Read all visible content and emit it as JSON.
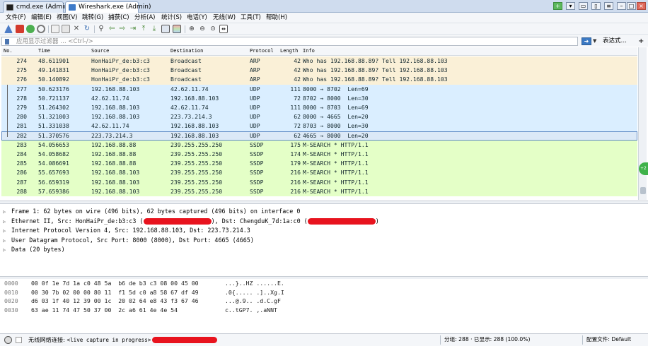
{
  "window": {
    "tabs": [
      {
        "label": "cmd.exe (Admin)",
        "active": false
      },
      {
        "label": "Wireshark.exe (Admin)",
        "active": true
      }
    ]
  },
  "menu": [
    "文件(F)",
    "编辑(E)",
    "视图(V)",
    "跳转(G)",
    "捕获(C)",
    "分析(A)",
    "统计(S)",
    "电话(Y)",
    "无线(W)",
    "工具(T)",
    "帮助(H)"
  ],
  "toolbar_icons": [
    "shark-fin-start-icon",
    "stop-icon",
    "restart-icon",
    "options-gear-icon",
    "open-file-icon",
    "save-file-icon",
    "close-file-icon",
    "reload-icon",
    "find-packet-icon",
    "go-back-icon",
    "go-forward-icon",
    "go-to-packet-icon",
    "first-packet-icon",
    "last-packet-icon",
    "autoscroll-icon",
    "colorize-icon",
    "zoom-in-icon",
    "zoom-out-icon",
    "normal-size-icon",
    "resize-columns-icon"
  ],
  "filter": {
    "placeholder": "应用显示过滤器 … <Ctrl-/>",
    "expression_label": "表达式…",
    "add_label": "+"
  },
  "packet_list": {
    "columns": [
      "No.",
      "Time",
      "Source",
      "Destination",
      "Protocol",
      "Length",
      "Info"
    ],
    "rows": [
      {
        "no": "274",
        "time": "48.611901",
        "src": "HonHaiPr_de:b3:c3",
        "dst": "Broadcast",
        "proto": "ARP",
        "len": "42",
        "info": "Who has 192.168.88.89? Tell 192.168.88.103",
        "cls": "arp"
      },
      {
        "no": "275",
        "time": "49.141831",
        "src": "HonHaiPr_de:b3:c3",
        "dst": "Broadcast",
        "proto": "ARP",
        "len": "42",
        "info": "Who has 192.168.88.89? Tell 192.168.88.103",
        "cls": "arp"
      },
      {
        "no": "276",
        "time": "50.140892",
        "src": "HonHaiPr_de:b3:c3",
        "dst": "Broadcast",
        "proto": "ARP",
        "len": "42",
        "info": "Who has 192.168.88.89? Tell 192.168.88.103",
        "cls": "arp"
      },
      {
        "no": "277",
        "time": "50.623176",
        "src": "192.168.88.103",
        "dst": "42.62.11.74",
        "proto": "UDP",
        "len": "111",
        "info": "8000 → 8702  Len=69",
        "cls": "udp"
      },
      {
        "no": "278",
        "time": "50.721137",
        "src": "42.62.11.74",
        "dst": "192.168.88.103",
        "proto": "UDP",
        "len": "72",
        "info": "8702 → 8000  Len=30",
        "cls": "udp"
      },
      {
        "no": "279",
        "time": "51.264302",
        "src": "192.168.88.103",
        "dst": "42.62.11.74",
        "proto": "UDP",
        "len": "111",
        "info": "8000 → 8703  Len=69",
        "cls": "udp"
      },
      {
        "no": "280",
        "time": "51.321003",
        "src": "192.168.88.103",
        "dst": "223.73.214.3",
        "proto": "UDP",
        "len": "62",
        "info": "8000 → 4665  Len=20",
        "cls": "udp"
      },
      {
        "no": "281",
        "time": "51.331038",
        "src": "42.62.11.74",
        "dst": "192.168.88.103",
        "proto": "UDP",
        "len": "72",
        "info": "8703 → 8000  Len=30",
        "cls": "udp"
      },
      {
        "no": "282",
        "time": "51.370576",
        "src": "223.73.214.3",
        "dst": "192.168.88.103",
        "proto": "UDP",
        "len": "62",
        "info": "4665 → 8000  Len=20",
        "cls": "udp selected"
      },
      {
        "no": "283",
        "time": "54.056653",
        "src": "192.168.88.88",
        "dst": "239.255.255.250",
        "proto": "SSDP",
        "len": "175",
        "info": "M-SEARCH * HTTP/1.1",
        "cls": "ssdp"
      },
      {
        "no": "284",
        "time": "54.058682",
        "src": "192.168.88.88",
        "dst": "239.255.255.250",
        "proto": "SSDP",
        "len": "174",
        "info": "M-SEARCH * HTTP/1.1",
        "cls": "ssdp"
      },
      {
        "no": "285",
        "time": "54.086691",
        "src": "192.168.88.88",
        "dst": "239.255.255.250",
        "proto": "SSDP",
        "len": "179",
        "info": "M-SEARCH * HTTP/1.1",
        "cls": "ssdp"
      },
      {
        "no": "286",
        "time": "55.657693",
        "src": "192.168.88.103",
        "dst": "239.255.255.250",
        "proto": "SSDP",
        "len": "216",
        "info": "M-SEARCH * HTTP/1.1",
        "cls": "ssdp"
      },
      {
        "no": "287",
        "time": "56.659319",
        "src": "192.168.88.103",
        "dst": "239.255.255.250",
        "proto": "SSDP",
        "len": "216",
        "info": "M-SEARCH * HTTP/1.1",
        "cls": "ssdp"
      },
      {
        "no": "288",
        "time": "57.659386",
        "src": "192.168.88.103",
        "dst": "239.255.255.250",
        "proto": "SSDP",
        "len": "216",
        "info": "M-SEARCH * HTTP/1.1",
        "cls": "ssdp"
      }
    ]
  },
  "details": {
    "frame": "Frame 1: 62 bytes on wire (496 bits), 62 bytes captured (496 bits) on interface 0",
    "ethernet_prefix": "Ethernet II, Src: HonHaiPr_de:b3:c3 (",
    "ethernet_mid": "), Dst: ChengduK_7d:1a:c0 (",
    "ethernet_suffix": ")",
    "ip": "Internet Protocol Version 4, Src: 192.168.88.103, Dst: 223.73.214.3",
    "udp": "User Datagram Protocol, Src Port: 8000 (8000), Dst Port: 4665 (4665)",
    "data": "Data (20 bytes)"
  },
  "bytes": [
    {
      "off": "0000",
      "hex": "00 0f 1e 7d 1a c0 48 5a  b6 de b3 c3 08 00 45 00",
      "ascii": "...}..HZ ......E."
    },
    {
      "off": "0010",
      "hex": "00 30 7b 02 00 00 80 11  f1 5d c0 a8 58 67 df 49",
      "ascii": ".0{..... .]..Xg.I"
    },
    {
      "off": "0020",
      "hex": "d6 03 1f 40 12 39 00 1c  20 02 64 e8 43 f3 67 46",
      "ascii": "...@.9.. .d.C.gF"
    },
    {
      "off": "0030",
      "hex": "63 ae 11 74 47 50 37 00  2c a6 61 4e 4e 54",
      "ascii": "c..tGP7. ,.aNNT"
    }
  ],
  "status": {
    "label": "无线网络连接:",
    "capture": "<live capture in progress>",
    "counts": "分组: 288 · 已显示: 288 (100.0%)",
    "profile": "配置文件: Default"
  },
  "colors": {
    "arp": "#faf0d7",
    "udp": "#daeeff",
    "ssdp": "#e4ffc7",
    "redaction": "#e8131e"
  }
}
